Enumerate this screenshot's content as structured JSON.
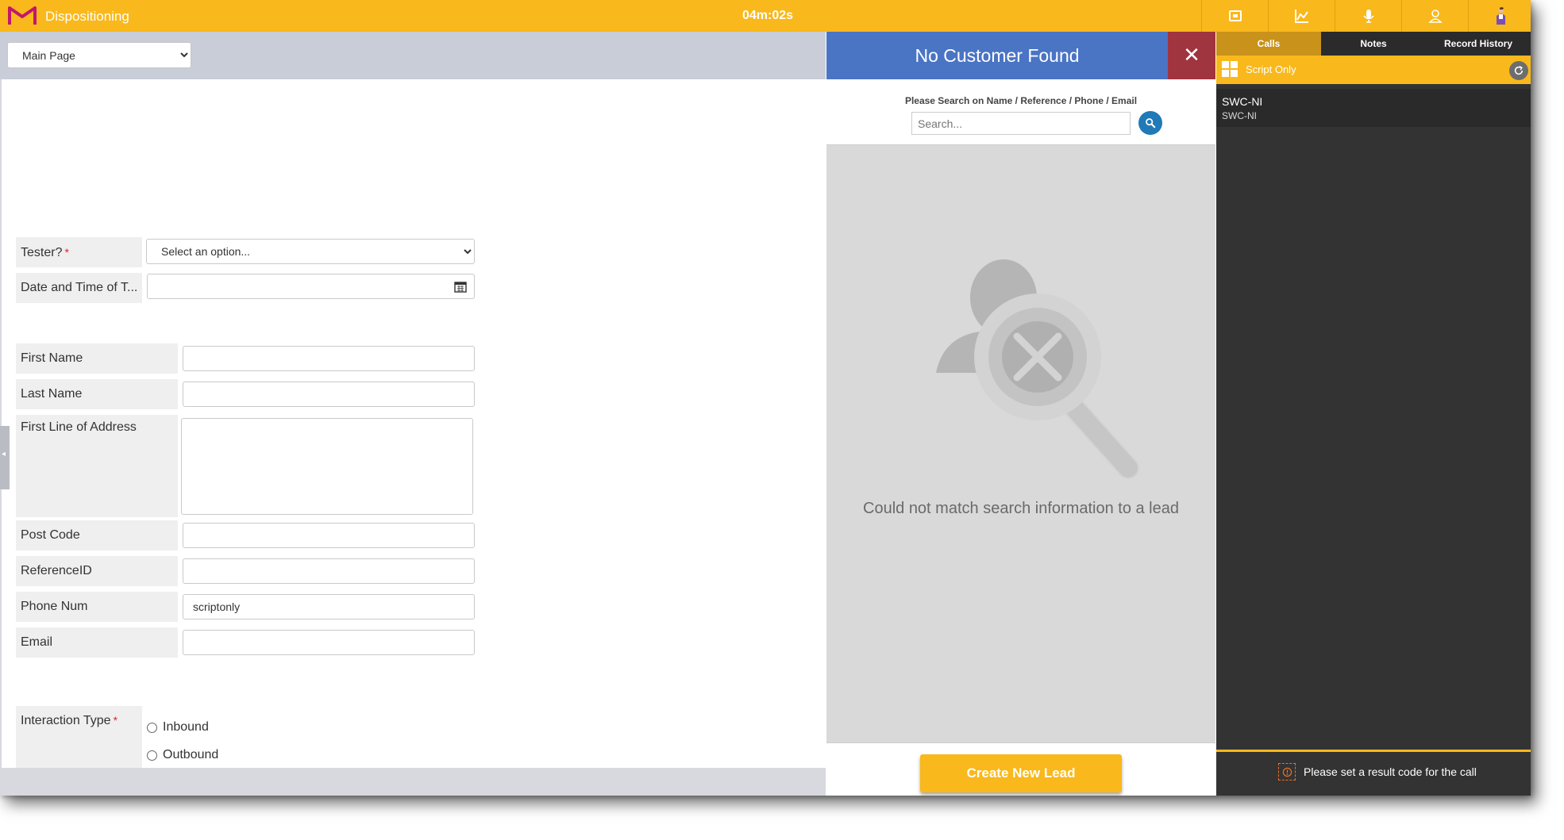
{
  "app": {
    "title": "Dispositioning",
    "timer": "04m:02s",
    "brand_color": "#f9b81b",
    "top_icons": [
      "calendar-icon",
      "chart-icon",
      "microphone-icon",
      "user-icon",
      "avatar"
    ]
  },
  "left": {
    "page_select": {
      "value": "Main Page"
    },
    "form": {
      "tester": {
        "label": "Tester?",
        "required_mark": "*",
        "placeholder": "Select an option..."
      },
      "datetime": {
        "label": "Date and Time of T...",
        "value": ""
      },
      "first_name": {
        "label": "First Name",
        "value": ""
      },
      "last_name": {
        "label": "Last Name",
        "value": ""
      },
      "address": {
        "label": "First Line of Address",
        "value": ""
      },
      "post_code": {
        "label": "Post Code",
        "value": ""
      },
      "reference_id": {
        "label": "ReferenceID",
        "value": ""
      },
      "phone": {
        "label": "Phone Num",
        "value": "scriptonly"
      },
      "email": {
        "label": "Email",
        "value": ""
      },
      "interaction_type": {
        "label": "Interaction Type",
        "required_mark": "*",
        "options": [
          "Inbound",
          "Outbound"
        ]
      }
    }
  },
  "middle": {
    "header": "No Customer Found",
    "close_glyph": "✕",
    "search_hint": "Please Search on Name / Reference / Phone / Email",
    "search_placeholder": "Search...",
    "message": "Could not match search information to a lead",
    "create_button": "Create New Lead"
  },
  "right": {
    "tabs": [
      "Calls",
      "Notes",
      "Record History"
    ],
    "active_tab": "Calls",
    "script_label": "Script Only",
    "call": {
      "title": "SWC-NI",
      "subtitle": "SWC-NI"
    },
    "result_message": "Please set a result code for the call"
  }
}
